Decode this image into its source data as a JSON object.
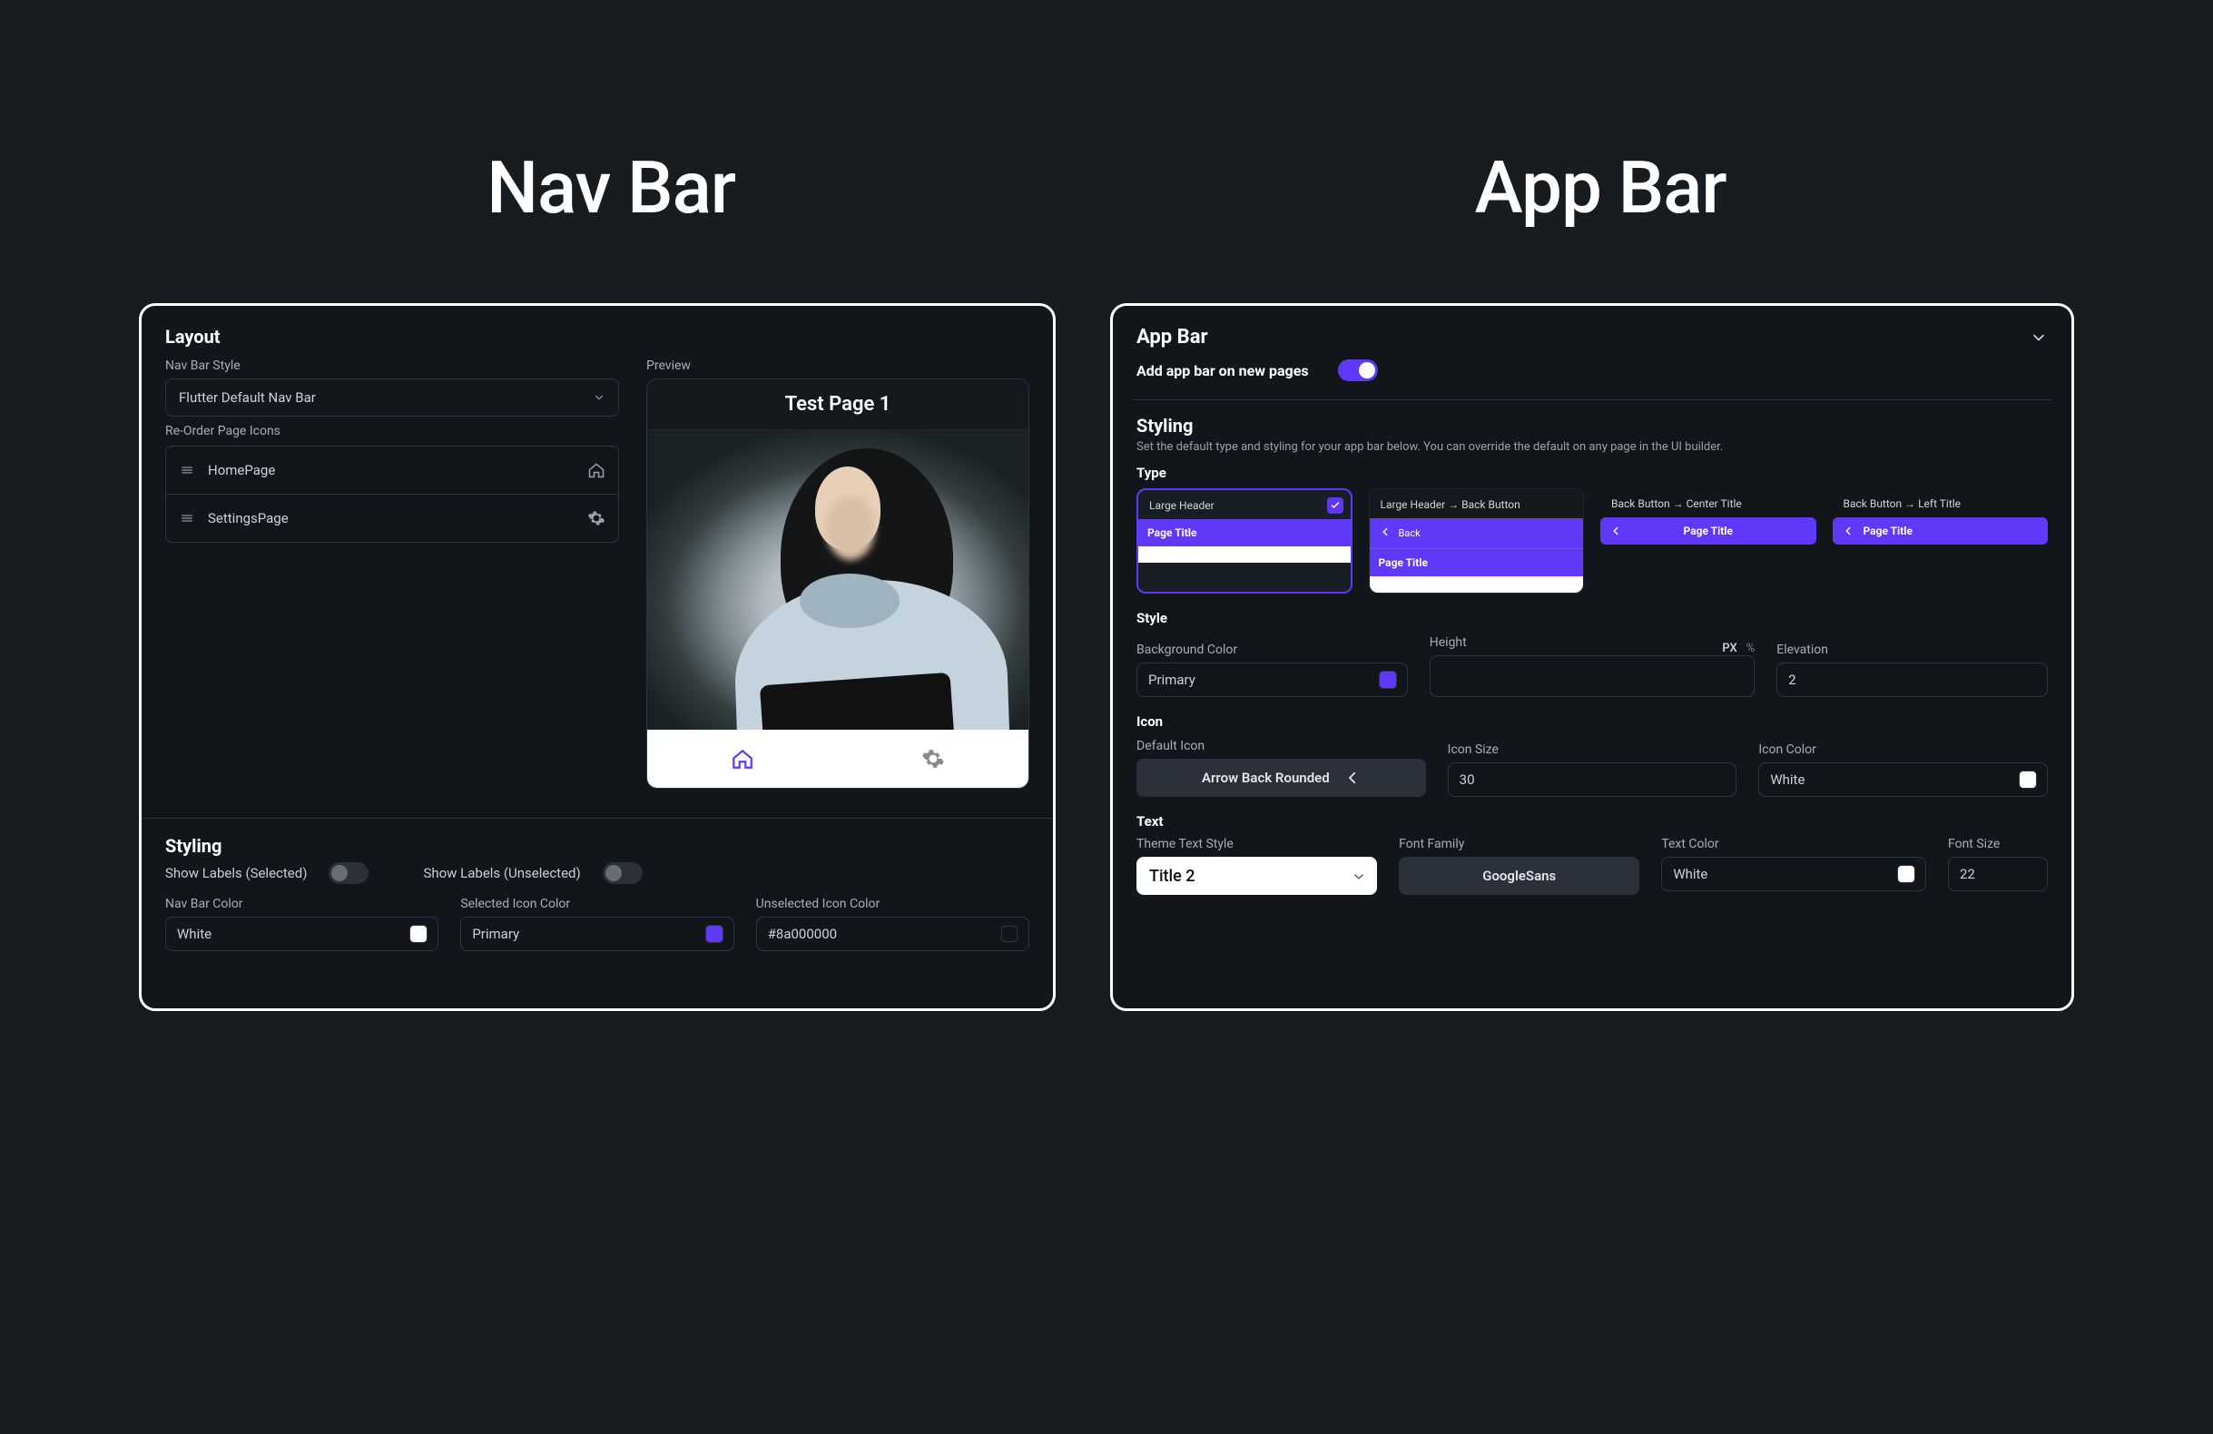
{
  "titles": {
    "left": "Nav Bar",
    "right": "App Bar"
  },
  "navbar": {
    "layout_header": "Layout",
    "navbar_style_label": "Nav Bar Style",
    "navbar_style_value": "Flutter Default Nav Bar",
    "reorder_label": "Re-Order Page Icons",
    "pages": [
      {
        "name": "HomePage",
        "icon": "home-icon"
      },
      {
        "name": "SettingsPage",
        "icon": "gear-icon"
      }
    ],
    "preview_label": "Preview",
    "preview_page_title": "Test Page 1",
    "styling_header": "Styling",
    "show_labels_selected_label": "Show Labels (Selected)",
    "show_labels_unselected_label": "Show Labels (Unselected)",
    "show_labels_selected_on": false,
    "show_labels_unselected_on": false,
    "colors": {
      "navbar_color": {
        "label": "Nav Bar Color",
        "value": "White",
        "swatch": "#ffffff"
      },
      "selected_icon_color": {
        "label": "Selected Icon Color",
        "value": "Primary",
        "swatch": "#5f39f7"
      },
      "unselected_icon_color": {
        "label": "Unselected Icon Color",
        "value": "#8a000000",
        "swatch": "#00000000"
      }
    }
  },
  "appbar": {
    "header": "App Bar",
    "add_on_new_pages_label": "Add app bar on new pages",
    "add_on_new_pages_on": true,
    "styling_header": "Styling",
    "styling_desc": "Set the default type and styling for your app bar below. You can override the default on any page in the UI builder.",
    "type_label": "Type",
    "types": [
      {
        "name": "Large Header",
        "selected": true,
        "demo_title": "Page Title",
        "layout": "large"
      },
      {
        "name": "Large Header → Back Button",
        "selected": false,
        "demo_title": "Page Title",
        "back_label": "Back",
        "layout": "large_back"
      },
      {
        "name": "Back Button → Center Title",
        "selected": false,
        "demo_title": "Page Title",
        "layout": "center"
      },
      {
        "name": "Back Button → Left Title",
        "selected": false,
        "demo_title": "Page Title",
        "layout": "left_back"
      }
    ],
    "style_header": "Style",
    "bg_color_label": "Background Color",
    "bg_color_value": "Primary",
    "bg_color_swatch": "#5f39f7",
    "height_label": "Height",
    "height_unit_px": "PX",
    "height_unit_pct": "%",
    "height_value": "",
    "elevation_label": "Elevation",
    "elevation_value": "2",
    "icon_header": "Icon",
    "default_icon_label": "Default Icon",
    "default_icon_name": "Arrow Back Rounded",
    "icon_size_label": "Icon Size",
    "icon_size_value": "30",
    "icon_color_label": "Icon Color",
    "icon_color_value": "White",
    "icon_color_swatch": "#ffffff",
    "text_header": "Text",
    "theme_text_style_label": "Theme Text Style",
    "theme_text_style_value": "Title 2",
    "font_family_label": "Font Family",
    "font_family_value": "GoogleSans",
    "text_color_label": "Text Color",
    "text_color_value": "White",
    "text_color_swatch": "#ffffff",
    "font_size_label": "Font Size",
    "font_size_value": "22"
  },
  "colors": {
    "accent": "#5f39f7"
  }
}
